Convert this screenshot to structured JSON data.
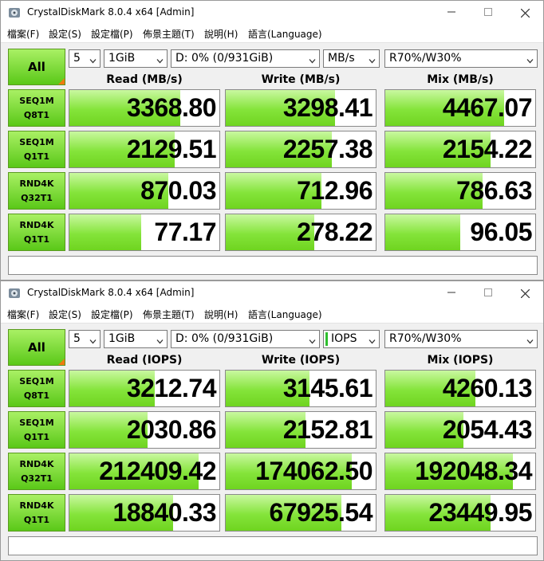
{
  "windows": [
    {
      "title": "CrystalDiskMark 8.0.4 x64 [Admin]",
      "menu": [
        "檔案(F)",
        "設定(S)",
        "設定檔(P)",
        "佈景主題(T)",
        "說明(H)",
        "語言(Language)"
      ],
      "all_label": "All",
      "controls": {
        "count": "5",
        "size": "1GiB",
        "drive": "D: 0% (0/931GiB)",
        "unit": "MB/s",
        "profile": "R70%/W30%"
      },
      "headers": [
        "Read (MB/s)",
        "Write (MB/s)",
        "Mix (MB/s)"
      ],
      "rows": [
        {
          "l1": "SEQ1M",
          "l2": "Q8T1",
          "values": [
            "3368.80",
            "3298.41",
            "4467.07"
          ],
          "fill": [
            0.74,
            0.73,
            0.79
          ]
        },
        {
          "l1": "SEQ1M",
          "l2": "Q1T1",
          "values": [
            "2129.51",
            "2257.38",
            "2154.22"
          ],
          "fill": [
            0.7,
            0.71,
            0.7
          ]
        },
        {
          "l1": "RND4K",
          "l2": "Q32T1",
          "values": [
            "870.03",
            "712.96",
            "786.63"
          ],
          "fill": [
            0.66,
            0.64,
            0.65
          ]
        },
        {
          "l1": "RND4K",
          "l2": "Q1T1",
          "values": [
            "77.17",
            "278.22",
            "96.05"
          ],
          "fill": [
            0.48,
            0.59,
            0.5
          ]
        }
      ],
      "status": ""
    },
    {
      "title": "CrystalDiskMark 8.0.4 x64 [Admin]",
      "menu": [
        "檔案(F)",
        "設定(S)",
        "設定檔(P)",
        "佈景主題(T)",
        "說明(H)",
        "語言(Language)"
      ],
      "all_label": "All",
      "controls": {
        "count": "5",
        "size": "1GiB",
        "drive": "D: 0% (0/931GiB)",
        "unit": "IOPS",
        "profile": "R70%/W30%"
      },
      "headers": [
        "Read (IOPS)",
        "Write (IOPS)",
        "Mix (IOPS)"
      ],
      "rows": [
        {
          "l1": "SEQ1M",
          "l2": "Q8T1",
          "values": [
            "3212.74",
            "3145.61",
            "4260.13"
          ],
          "fill": [
            0.57,
            0.56,
            0.6
          ]
        },
        {
          "l1": "SEQ1M",
          "l2": "Q1T1",
          "values": [
            "2030.86",
            "2152.81",
            "2054.43"
          ],
          "fill": [
            0.52,
            0.53,
            0.52
          ]
        },
        {
          "l1": "RND4K",
          "l2": "Q32T1",
          "values": [
            "212409.42",
            "174062.50",
            "192048.34"
          ],
          "fill": [
            0.86,
            0.84,
            0.85
          ]
        },
        {
          "l1": "RND4K",
          "l2": "Q1T1",
          "values": [
            "18840.33",
            "67925.54",
            "23449.95"
          ],
          "fill": [
            0.69,
            0.77,
            0.7
          ]
        }
      ],
      "status": ""
    }
  ],
  "colors": {
    "accent_green": "#84e43a",
    "label_green": "#5ac818",
    "corner_orange": "#f07a10"
  }
}
